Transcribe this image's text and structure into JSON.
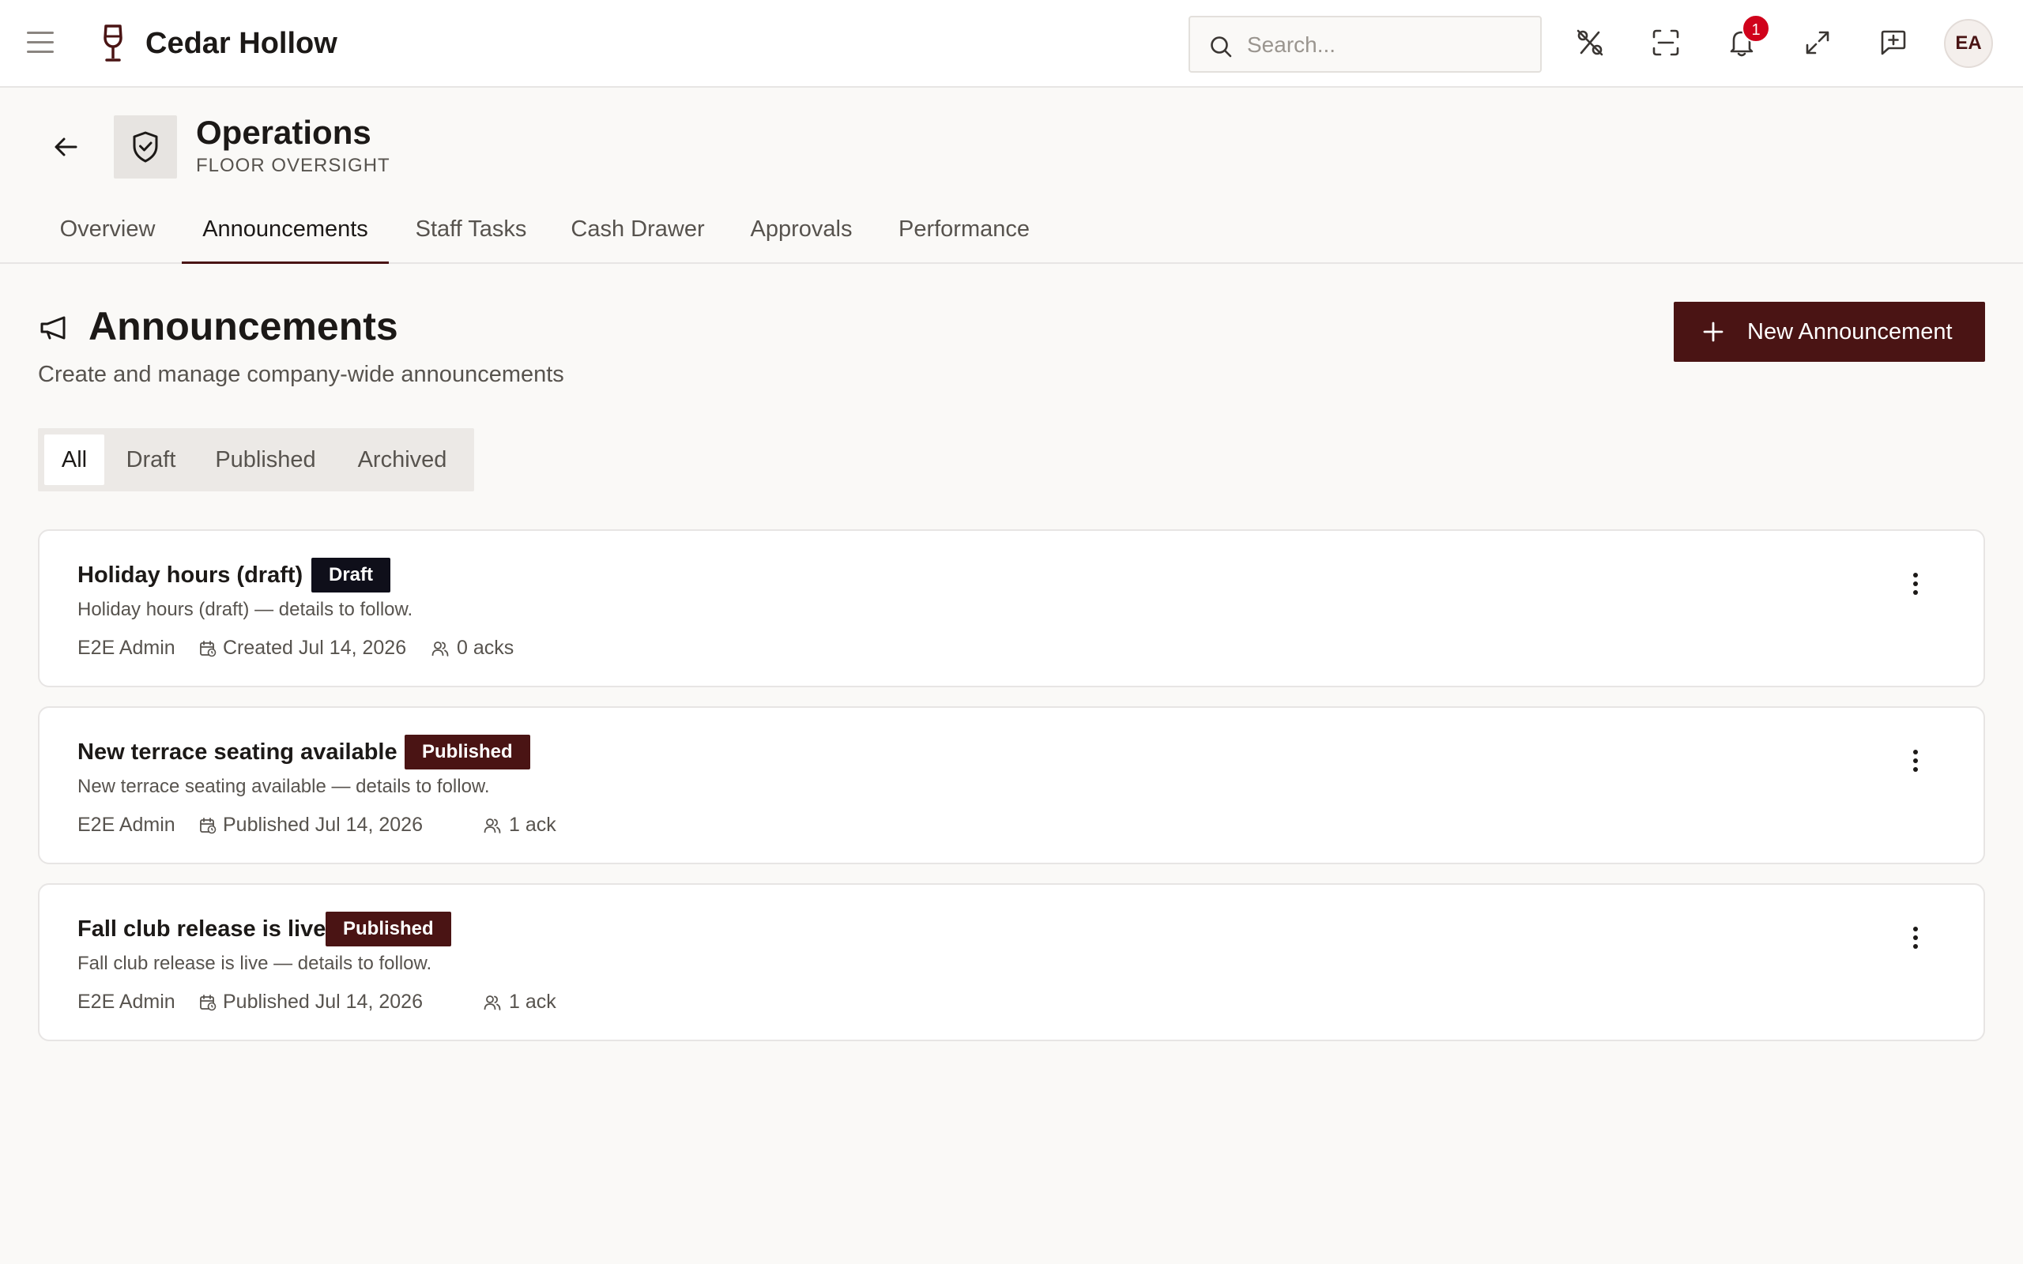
{
  "app": {
    "brand_name": "Cedar Hollow",
    "brand_color": "#4a1414"
  },
  "header": {
    "search_placeholder": "Search...",
    "notification_count": "1",
    "avatar_initials": "EA",
    "icons": [
      "menu-icon",
      "wine-glass-icon",
      "search-icon",
      "percent-slash-icon",
      "scan-icon",
      "bell-icon",
      "expand-icon",
      "feedback-icon"
    ]
  },
  "page": {
    "title": "Operations",
    "subtitle": "FLOOR OVERSIGHT"
  },
  "tabs": [
    {
      "label": "Overview",
      "active": false
    },
    {
      "label": "Announcements",
      "active": true
    },
    {
      "label": "Staff Tasks",
      "active": false
    },
    {
      "label": "Cash Drawer",
      "active": false
    },
    {
      "label": "Approvals",
      "active": false
    },
    {
      "label": "Performance",
      "active": false
    }
  ],
  "section": {
    "title": "Announcements",
    "description": "Create and manage company-wide announcements",
    "new_button_label": "New Announcement"
  },
  "filters": [
    {
      "label": "All",
      "active": true
    },
    {
      "label": "Draft",
      "active": false
    },
    {
      "label": "Published",
      "active": false
    },
    {
      "label": "Archived",
      "active": false
    }
  ],
  "announcements": [
    {
      "title": "Holiday hours (draft)",
      "status": "Draft",
      "body": "Holiday hours (draft) — details to follow.",
      "author": "E2E Admin",
      "date_text": "Created Jul 14, 2026",
      "acks_text": "0 acks"
    },
    {
      "title": "New terrace seating available",
      "status": "Published",
      "body": "New terrace seating available — details to follow.",
      "author": "E2E Admin",
      "date_text": "Published Jul 14, 2026",
      "acks_text": "1 ack"
    },
    {
      "title": "Fall club release is live",
      "status": "Published",
      "body": "Fall club release is live — details to follow.",
      "author": "E2E Admin",
      "date_text": "Published Jul 14, 2026",
      "acks_text": "1 ack"
    }
  ]
}
